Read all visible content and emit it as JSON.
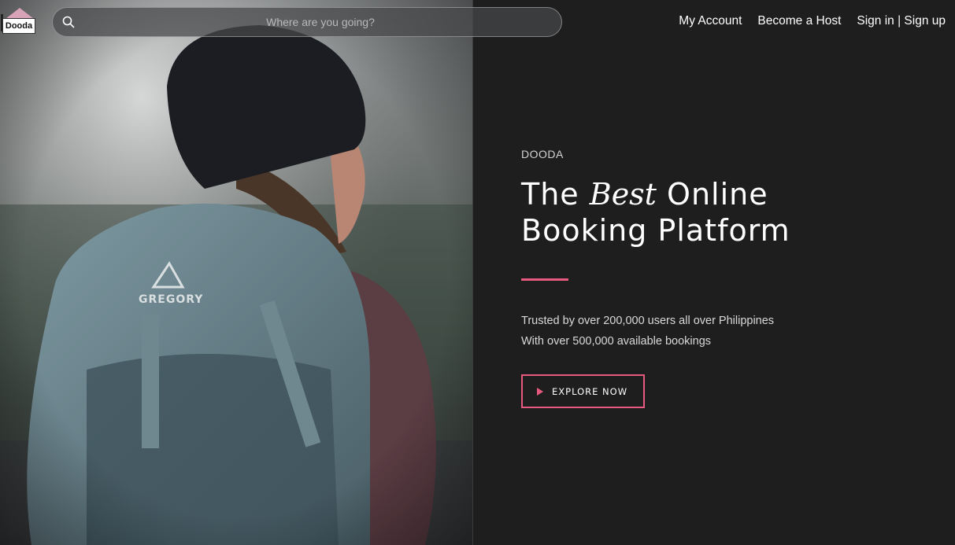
{
  "logo": {
    "text": "Dooda"
  },
  "search": {
    "placeholder": "Where are you going?",
    "value": ""
  },
  "nav": {
    "my_account": "My Account",
    "become_host": "Become a Host",
    "sign_in_up": "Sign in | Sign up"
  },
  "hero": {
    "brand": "DOODA",
    "headline_pre": "The ",
    "headline_best": "Best",
    "headline_line1_post": " Online",
    "headline_line2": "Booking Platform",
    "tagline_1": "Trusted by over 200,000 users all over Philippines",
    "tagline_2": "With over 500,000 available bookings",
    "cta_label": "EXPLORE NOW"
  },
  "colors": {
    "background": "#1e1e1f",
    "accent": "#e8597f",
    "text": "#ffffff"
  },
  "icons": {
    "search": "search-icon",
    "play": "play-icon"
  }
}
